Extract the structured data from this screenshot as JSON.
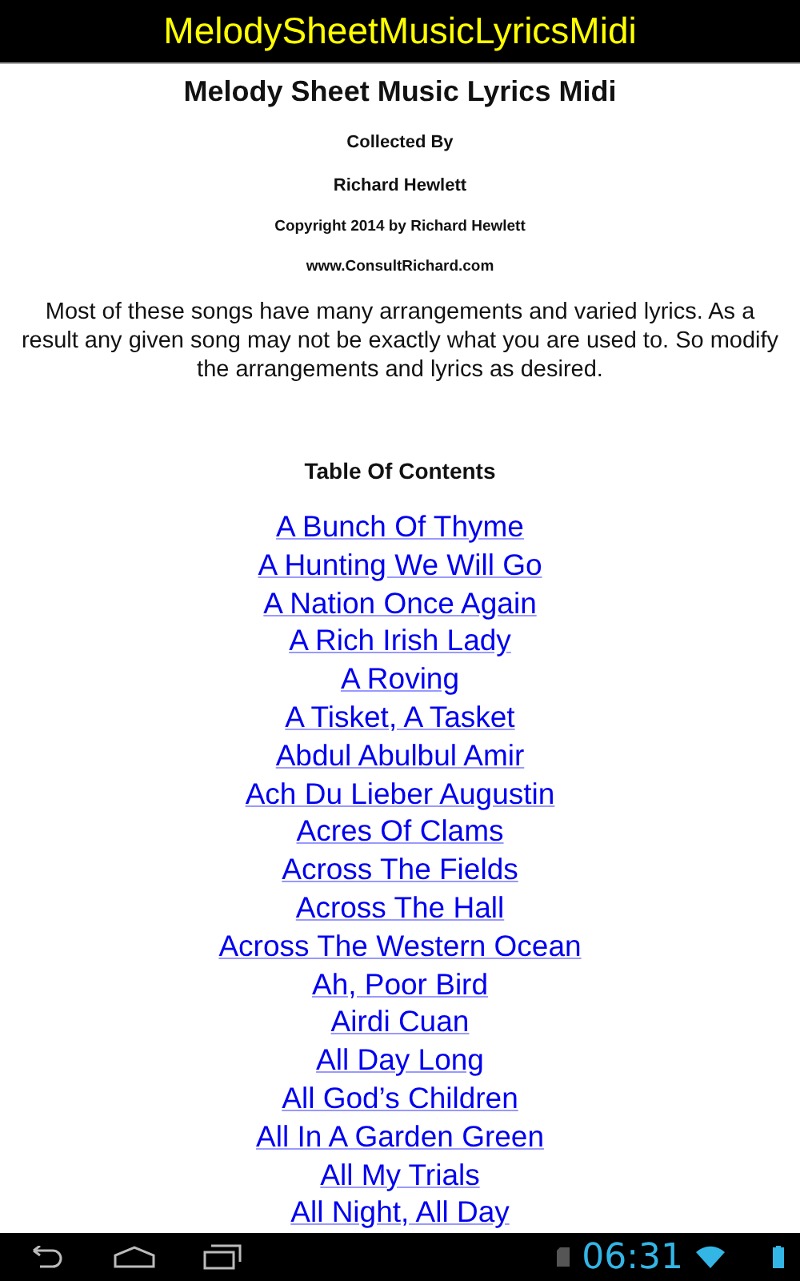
{
  "title_bar": {
    "title": "MelodySheetMusicLyricsMidi"
  },
  "header": {
    "heading": "Melody Sheet Music Lyrics Midi",
    "collected_by": "Collected By",
    "author": "Richard Hewlett",
    "copyright": "Copyright 2014 by Richard Hewlett",
    "website": "www.ConsultRichard.com"
  },
  "intro": "Most of these songs have many arrangements and varied lyrics. As a result any given song may not be exactly what you are used to. So modify the arrangements and lyrics as desired.",
  "toc": {
    "heading": "Table Of Contents",
    "links": [
      "A Bunch Of Thyme",
      "A Hunting We Will Go",
      "A Nation Once Again",
      "A Rich Irish Lady",
      "A Roving",
      "A Tisket, A Tasket",
      "Abdul Abulbul Amir",
      "Ach Du Lieber Augustin",
      "Acres Of Clams",
      "Across The Fields",
      "Across The Hall",
      "Across The Western Ocean",
      "Ah, Poor Bird",
      "Airdi Cuan",
      "All Day Long",
      "All God’s Children",
      "All In A Garden Green",
      "All My Trials",
      "All Night, All Day"
    ]
  },
  "status_bar": {
    "time": "06:31"
  }
}
